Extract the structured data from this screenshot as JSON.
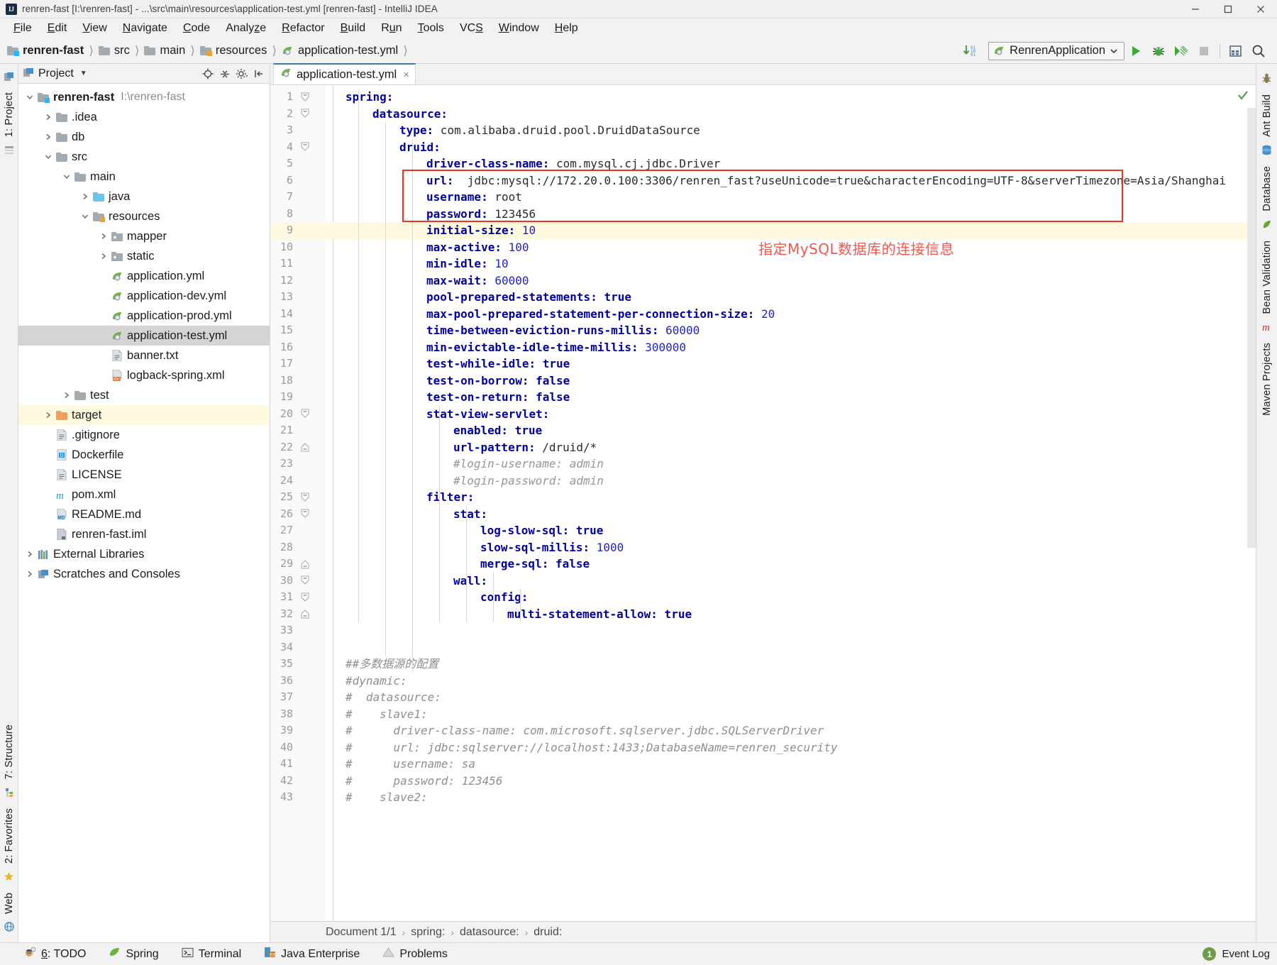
{
  "window": {
    "title": "renren-fast [I:\\renren-fast] - ...\\src\\main\\resources\\application-test.yml [renren-fast] - IntelliJ IDEA",
    "minimize_label": "minimize-window",
    "maximize_label": "maximize-window",
    "close_label": "close-window"
  },
  "menu": [
    {
      "label": "File"
    },
    {
      "label": "Edit"
    },
    {
      "label": "View"
    },
    {
      "label": "Navigate"
    },
    {
      "label": "Code"
    },
    {
      "label": "Analyze"
    },
    {
      "label": "Refactor"
    },
    {
      "label": "Build"
    },
    {
      "label": "Run"
    },
    {
      "label": "Tools"
    },
    {
      "label": "VCS"
    },
    {
      "label": "Window"
    },
    {
      "label": "Help"
    }
  ],
  "breadcrumbs": [
    {
      "label": "renren-fast",
      "icon": "module-icon",
      "bold": true
    },
    {
      "label": "src",
      "icon": "folder-icon",
      "bold": false
    },
    {
      "label": "main",
      "icon": "folder-icon",
      "bold": false
    },
    {
      "label": "resources",
      "icon": "resources-folder-icon",
      "bold": false
    },
    {
      "label": "application-test.yml",
      "icon": "spring-yml-icon",
      "bold": false
    }
  ],
  "toolbar": {
    "update_project_label": "update-project-icon",
    "run_configuration": "RenrenApplication",
    "run_label": "run-button",
    "debug_label": "debug-button",
    "coverage_label": "run-with-coverage-button",
    "stop_label": "stop-button",
    "layout_label": "toggle-layout-button",
    "search_label": "search-everywhere-button"
  },
  "project_panel": {
    "title": "Project",
    "tool_buttons": [
      "locate-icon",
      "collapse-all-icon",
      "settings-icon",
      "hide-icon"
    ],
    "tree": [
      {
        "label": "renren-fast",
        "path": "I:\\renren-fast",
        "depth": 0,
        "arrow": "down",
        "icon": "module-icon",
        "bold": true,
        "state": "normal"
      },
      {
        "label": ".idea",
        "depth": 1,
        "arrow": "right",
        "icon": "folder-icon",
        "state": "normal"
      },
      {
        "label": "db",
        "depth": 1,
        "arrow": "right",
        "icon": "folder-icon",
        "state": "normal"
      },
      {
        "label": "src",
        "depth": 1,
        "arrow": "down",
        "icon": "folder-icon",
        "state": "normal"
      },
      {
        "label": "main",
        "depth": 2,
        "arrow": "down",
        "icon": "folder-icon",
        "state": "normal"
      },
      {
        "label": "java",
        "depth": 3,
        "arrow": "right",
        "icon": "sources-folder-icon",
        "state": "normal"
      },
      {
        "label": "resources",
        "depth": 3,
        "arrow": "down",
        "icon": "resources-folder-icon",
        "state": "normal"
      },
      {
        "label": "mapper",
        "depth": 4,
        "arrow": "right",
        "icon": "package-folder-icon",
        "state": "normal"
      },
      {
        "label": "static",
        "depth": 4,
        "arrow": "right",
        "icon": "package-folder-icon",
        "state": "normal"
      },
      {
        "label": "application.yml",
        "depth": 4,
        "arrow": "none",
        "icon": "spring-yml-icon",
        "state": "normal"
      },
      {
        "label": "application-dev.yml",
        "depth": 4,
        "arrow": "none",
        "icon": "spring-yml-icon",
        "state": "normal"
      },
      {
        "label": "application-prod.yml",
        "depth": 4,
        "arrow": "none",
        "icon": "spring-yml-icon",
        "state": "normal"
      },
      {
        "label": "application-test.yml",
        "depth": 4,
        "arrow": "none",
        "icon": "spring-yml-icon",
        "state": "selected"
      },
      {
        "label": "banner.txt",
        "depth": 4,
        "arrow": "none",
        "icon": "text-file-icon",
        "state": "normal"
      },
      {
        "label": "logback-spring.xml",
        "depth": 4,
        "arrow": "none",
        "icon": "xml-file-icon",
        "state": "normal"
      },
      {
        "label": "test",
        "depth": 2,
        "arrow": "right",
        "icon": "folder-icon",
        "state": "normal"
      },
      {
        "label": "target",
        "depth": 1,
        "arrow": "right",
        "icon": "excluded-folder-icon",
        "state": "highlighted"
      },
      {
        "label": ".gitignore",
        "depth": 1,
        "arrow": "none",
        "icon": "text-file-icon",
        "state": "normal"
      },
      {
        "label": "Dockerfile",
        "depth": 1,
        "arrow": "none",
        "icon": "docker-file-icon",
        "state": "normal"
      },
      {
        "label": "LICENSE",
        "depth": 1,
        "arrow": "none",
        "icon": "text-file-icon",
        "state": "normal"
      },
      {
        "label": "pom.xml",
        "depth": 1,
        "arrow": "none",
        "icon": "maven-pom-icon",
        "state": "normal"
      },
      {
        "label": "README.md",
        "depth": 1,
        "arrow": "none",
        "icon": "markdown-file-icon",
        "state": "normal"
      },
      {
        "label": "renren-fast.iml",
        "depth": 1,
        "arrow": "none",
        "icon": "iml-file-icon",
        "state": "normal"
      },
      {
        "label": "External Libraries",
        "depth": 0,
        "arrow": "right",
        "icon": "libraries-icon",
        "state": "normal"
      },
      {
        "label": "Scratches and Consoles",
        "depth": 0,
        "arrow": "right",
        "icon": "scratches-icon",
        "state": "normal"
      }
    ]
  },
  "left_strip": {
    "top": [
      {
        "label": "1: Project",
        "icon": "project-tool-icon"
      }
    ],
    "bottom": [
      {
        "label": "7: Structure",
        "icon": "structure-tool-icon"
      },
      {
        "label": "2: Favorites",
        "icon": "favorites-tool-icon"
      },
      {
        "label": "Web",
        "icon": "web-tool-icon"
      }
    ]
  },
  "right_strip": [
    {
      "label": "Ant Build",
      "icon": "ant-icon"
    },
    {
      "label": "Database",
      "icon": "database-icon"
    },
    {
      "label": "Bean Validation",
      "icon": "bean-validation-icon"
    },
    {
      "label": "Maven Projects",
      "icon": "maven-icon"
    }
  ],
  "editor": {
    "tab": {
      "label": "application-test.yml",
      "icon": "spring-yml-icon",
      "close": "×"
    },
    "breadcrumb": [
      "Document 1/1",
      "spring:",
      "datasource:",
      "druid:"
    ],
    "highlighted_line": 9,
    "annotation": "指定MySQL数据库的连接信息",
    "annotation_color": "#f4574e",
    "highlight_box_color": "#ee3322",
    "highlight_box_lines": [
      6,
      8
    ],
    "inspection_status": "inspections-ok-icon",
    "lines": [
      {
        "n": 1,
        "indent": 0,
        "fold": "start",
        "tokens": [
          [
            "k",
            "spring:"
          ]
        ]
      },
      {
        "n": 2,
        "indent": 2,
        "fold": "start",
        "tokens": [
          [
            "k",
            "datasource:"
          ]
        ]
      },
      {
        "n": 3,
        "indent": 4,
        "fold": "none",
        "tokens": [
          [
            "k",
            "type:"
          ],
          [
            "v",
            " com.alibaba.druid.pool.DruidDataSource"
          ]
        ]
      },
      {
        "n": 4,
        "indent": 4,
        "fold": "start",
        "tokens": [
          [
            "k",
            "druid:"
          ]
        ]
      },
      {
        "n": 5,
        "indent": 6,
        "fold": "none",
        "tokens": [
          [
            "k",
            "driver-class-name:"
          ],
          [
            "v",
            " com.mysql.cj.jdbc.Driver"
          ]
        ]
      },
      {
        "n": 6,
        "indent": 6,
        "fold": "none",
        "tokens": [
          [
            "k",
            "url:"
          ],
          [
            "v",
            "  jdbc:mysql://172.20.0.100:3306/renren_fast?useUnicode=true&characterEncoding=UTF-8&serverTimezone=Asia/Shanghai"
          ]
        ]
      },
      {
        "n": 7,
        "indent": 6,
        "fold": "none",
        "tokens": [
          [
            "k",
            "username:"
          ],
          [
            "v",
            " root"
          ]
        ]
      },
      {
        "n": 8,
        "indent": 6,
        "fold": "none",
        "tokens": [
          [
            "k",
            "password:"
          ],
          [
            "v",
            " 123456"
          ]
        ]
      },
      {
        "n": 9,
        "indent": 6,
        "fold": "none",
        "tokens": [
          [
            "k",
            "initial-size:"
          ],
          [
            "n",
            " 10"
          ]
        ]
      },
      {
        "n": 10,
        "indent": 6,
        "fold": "none",
        "tokens": [
          [
            "k",
            "max-active:"
          ],
          [
            "n",
            " 100"
          ]
        ]
      },
      {
        "n": 11,
        "indent": 6,
        "fold": "none",
        "tokens": [
          [
            "k",
            "min-idle:"
          ],
          [
            "n",
            " 10"
          ]
        ]
      },
      {
        "n": 12,
        "indent": 6,
        "fold": "none",
        "tokens": [
          [
            "k",
            "max-wait:"
          ],
          [
            "n",
            " 60000"
          ]
        ]
      },
      {
        "n": 13,
        "indent": 6,
        "fold": "none",
        "tokens": [
          [
            "k",
            "pool-prepared-statements:"
          ],
          [
            "k",
            " true"
          ]
        ]
      },
      {
        "n": 14,
        "indent": 6,
        "fold": "none",
        "tokens": [
          [
            "k",
            "max-pool-prepared-statement-per-connection-size:"
          ],
          [
            "n",
            " 20"
          ]
        ]
      },
      {
        "n": 15,
        "indent": 6,
        "fold": "none",
        "tokens": [
          [
            "k",
            "time-between-eviction-runs-millis:"
          ],
          [
            "n",
            " 60000"
          ]
        ]
      },
      {
        "n": 16,
        "indent": 6,
        "fold": "none",
        "tokens": [
          [
            "k",
            "min-evictable-idle-time-millis:"
          ],
          [
            "n",
            " 300000"
          ]
        ]
      },
      {
        "n": 17,
        "indent": 6,
        "fold": "none",
        "tokens": [
          [
            "k",
            "test-while-idle:"
          ],
          [
            "k",
            " true"
          ]
        ]
      },
      {
        "n": 18,
        "indent": 6,
        "fold": "none",
        "tokens": [
          [
            "k",
            "test-on-borrow:"
          ],
          [
            "k",
            " false"
          ]
        ]
      },
      {
        "n": 19,
        "indent": 6,
        "fold": "none",
        "tokens": [
          [
            "k",
            "test-on-return:"
          ],
          [
            "k",
            " false"
          ]
        ]
      },
      {
        "n": 20,
        "indent": 6,
        "fold": "start",
        "tokens": [
          [
            "k",
            "stat-view-servlet:"
          ]
        ]
      },
      {
        "n": 21,
        "indent": 8,
        "fold": "none",
        "tokens": [
          [
            "k",
            "enabled:"
          ],
          [
            "k",
            " true"
          ]
        ]
      },
      {
        "n": 22,
        "indent": 8,
        "fold": "end",
        "tokens": [
          [
            "k",
            "url-pattern:"
          ],
          [
            "v",
            " /druid/*"
          ]
        ]
      },
      {
        "n": 23,
        "indent": 8,
        "fold": "none",
        "tokens": [
          [
            "c",
            "#login-username: admin"
          ]
        ]
      },
      {
        "n": 24,
        "indent": 8,
        "fold": "none",
        "tokens": [
          [
            "c",
            "#login-password: admin"
          ]
        ]
      },
      {
        "n": 25,
        "indent": 6,
        "fold": "start",
        "tokens": [
          [
            "k",
            "filter:"
          ]
        ]
      },
      {
        "n": 26,
        "indent": 8,
        "fold": "start",
        "tokens": [
          [
            "k",
            "stat:"
          ]
        ]
      },
      {
        "n": 27,
        "indent": 10,
        "fold": "none",
        "tokens": [
          [
            "k",
            "log-slow-sql:"
          ],
          [
            "k",
            " true"
          ]
        ]
      },
      {
        "n": 28,
        "indent": 10,
        "fold": "none",
        "tokens": [
          [
            "k",
            "slow-sql-millis:"
          ],
          [
            "n",
            " 1000"
          ]
        ]
      },
      {
        "n": 29,
        "indent": 10,
        "fold": "end",
        "tokens": [
          [
            "k",
            "merge-sql:"
          ],
          [
            "k",
            " false"
          ]
        ]
      },
      {
        "n": 30,
        "indent": 8,
        "fold": "start",
        "tokens": [
          [
            "k",
            "wall:"
          ]
        ]
      },
      {
        "n": 31,
        "indent": 10,
        "fold": "start",
        "tokens": [
          [
            "k",
            "config:"
          ]
        ]
      },
      {
        "n": 32,
        "indent": 12,
        "fold": "end",
        "tokens": [
          [
            "k",
            "multi-statement-allow:"
          ],
          [
            "k",
            " true"
          ]
        ]
      },
      {
        "n": 33,
        "indent": 0,
        "fold": "none",
        "tokens": []
      },
      {
        "n": 34,
        "indent": 0,
        "fold": "none",
        "tokens": []
      },
      {
        "n": 35,
        "indent": 0,
        "fold": "none",
        "tokens": [
          [
            "cb",
            "##多数据源的配置"
          ]
        ]
      },
      {
        "n": 36,
        "indent": 0,
        "fold": "none",
        "tokens": [
          [
            "cb",
            "#dynamic:"
          ]
        ]
      },
      {
        "n": 37,
        "indent": 0,
        "fold": "none",
        "tokens": [
          [
            "cb",
            "#  datasource:"
          ]
        ]
      },
      {
        "n": 38,
        "indent": 0,
        "fold": "none",
        "tokens": [
          [
            "cb",
            "#    slave1:"
          ]
        ]
      },
      {
        "n": 39,
        "indent": 0,
        "fold": "none",
        "tokens": [
          [
            "cb",
            "#      driver-class-name: com.microsoft.sqlserver.jdbc.SQLServerDriver"
          ]
        ]
      },
      {
        "n": 40,
        "indent": 0,
        "fold": "none",
        "tokens": [
          [
            "cb",
            "#      url: jdbc:sqlserver://localhost:1433;DatabaseName=renren_security"
          ]
        ]
      },
      {
        "n": 41,
        "indent": 0,
        "fold": "none",
        "tokens": [
          [
            "cb",
            "#      username: sa"
          ]
        ]
      },
      {
        "n": 42,
        "indent": 0,
        "fold": "none",
        "tokens": [
          [
            "cb",
            "#      password: 123456"
          ]
        ]
      },
      {
        "n": 43,
        "indent": 0,
        "fold": "none",
        "tokens": [
          [
            "cb",
            "#    slave2:"
          ]
        ]
      }
    ]
  },
  "status_bar": {
    "items": [
      {
        "label": "6: TODO",
        "icon": "todo-icon",
        "underline_first": true
      },
      {
        "label": "Spring",
        "icon": "spring-icon"
      },
      {
        "label": "Terminal",
        "icon": "terminal-icon"
      },
      {
        "label": "Java Enterprise",
        "icon": "java-enterprise-icon"
      },
      {
        "label": "Problems",
        "icon": "problems-icon"
      }
    ],
    "event_log": {
      "count": "1",
      "label": "Event Log"
    }
  }
}
